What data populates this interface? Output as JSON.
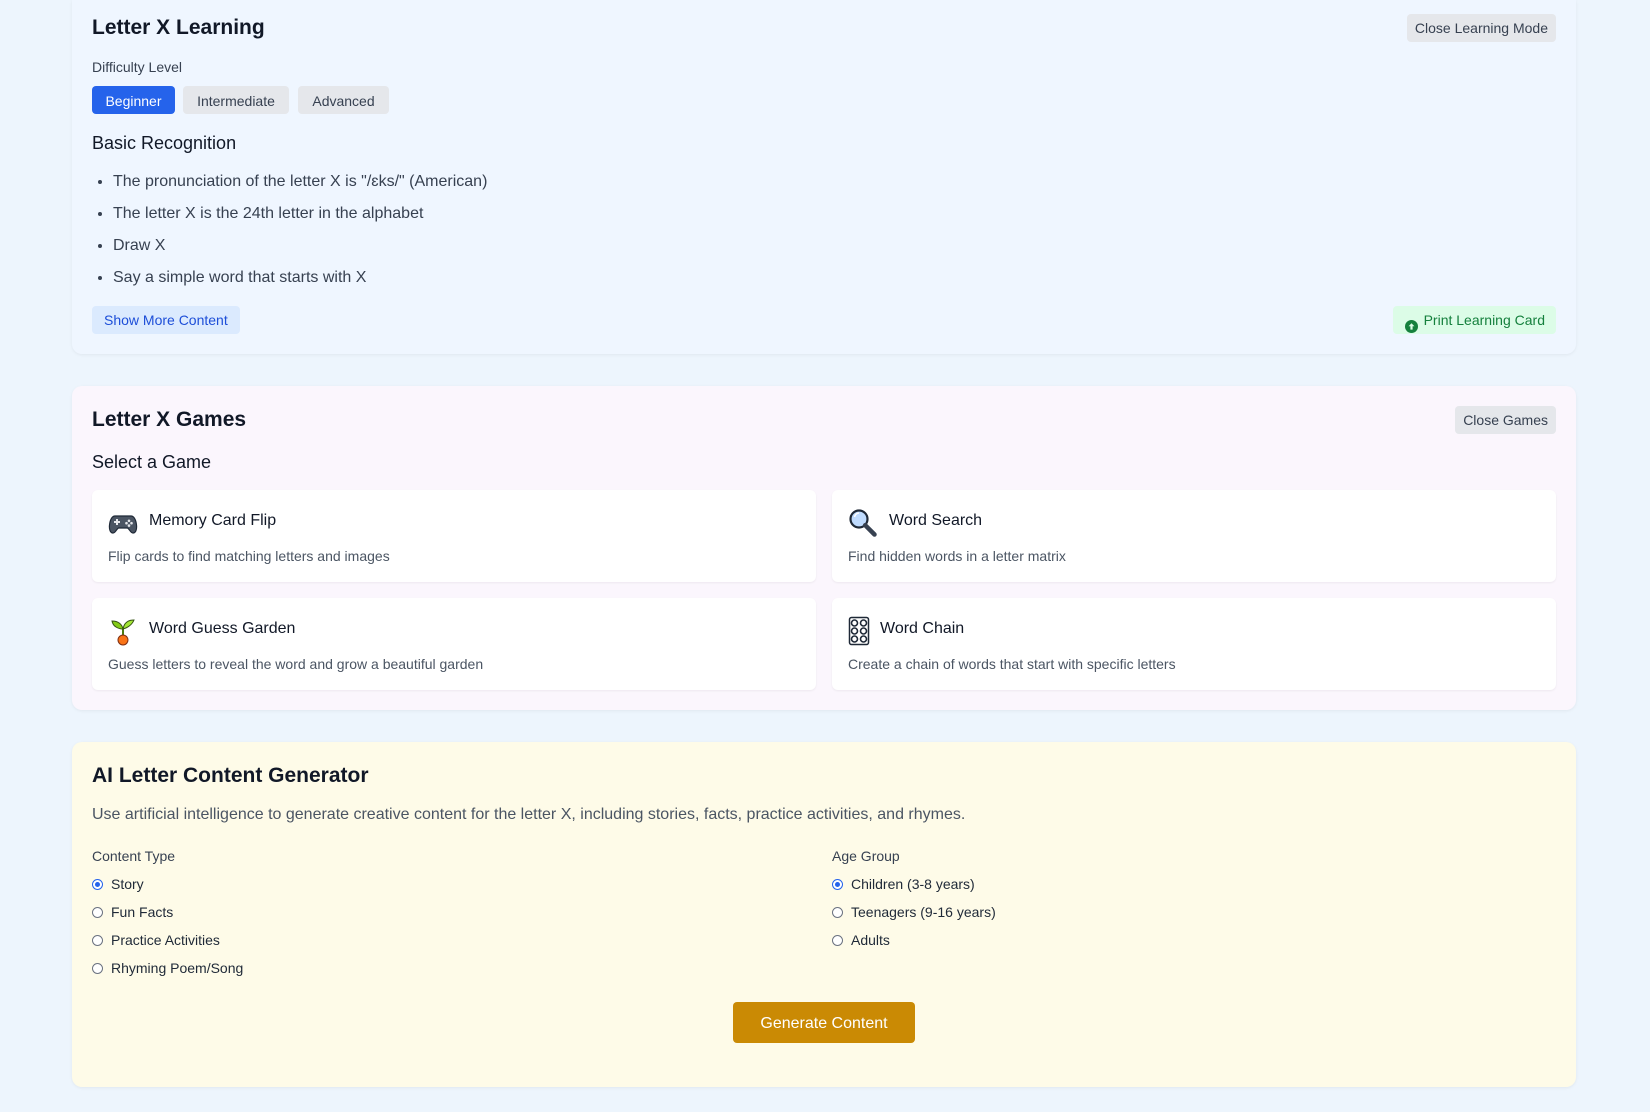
{
  "learning": {
    "title": "Letter X Learning",
    "close_label": "Close Learning Mode",
    "difficulty_label": "Difficulty Level",
    "difficulty_options": [
      "Beginner",
      "Intermediate",
      "Advanced"
    ],
    "selected_difficulty": "Beginner",
    "section_title": "Basic Recognition",
    "points": [
      "The pronunciation of the letter X is \"/ɛks/\" (American)",
      "The letter X is the 24th letter in the alphabet",
      "Draw X",
      "Say a simple word that starts with X"
    ],
    "show_more_label": "Show More Content",
    "print_label": "Print Learning Card",
    "print_icon": "arrow-up-circle-icon"
  },
  "games": {
    "title": "Letter X Games",
    "close_label": "Close Games",
    "select_label": "Select a Game",
    "items": [
      {
        "name": "Memory Card Flip",
        "description": "Flip cards to find matching letters and images",
        "icon": "game-controller-icon"
      },
      {
        "name": "Word Search",
        "description": "Find hidden words in a letter matrix",
        "icon": "magnifying-glass-icon"
      },
      {
        "name": "Word Guess Garden",
        "description": "Guess letters to reveal the word and grow a beautiful garden",
        "icon": "seedling-icon"
      },
      {
        "name": "Word Chain",
        "description": "Create a chain of words that start with specific letters",
        "icon": "chain-icon"
      }
    ]
  },
  "ai": {
    "title": "AI Letter Content Generator",
    "description": "Use artificial intelligence to generate creative content for the letter X, including stories, facts, practice activities, and rhymes.",
    "content_type_label": "Content Type",
    "content_types": [
      "Story",
      "Fun Facts",
      "Practice Activities",
      "Rhyming Poem/Song"
    ],
    "selected_content_type": "Story",
    "age_group_label": "Age Group",
    "age_groups": [
      "Children (3-8 years)",
      "Teenagers (9-16 years)",
      "Adults"
    ],
    "selected_age_group": "Children (3-8 years)",
    "generate_label": "Generate Content"
  },
  "colors": {
    "primary": "#2563eb",
    "success": "#15803d",
    "generate": "#ca8a04"
  }
}
